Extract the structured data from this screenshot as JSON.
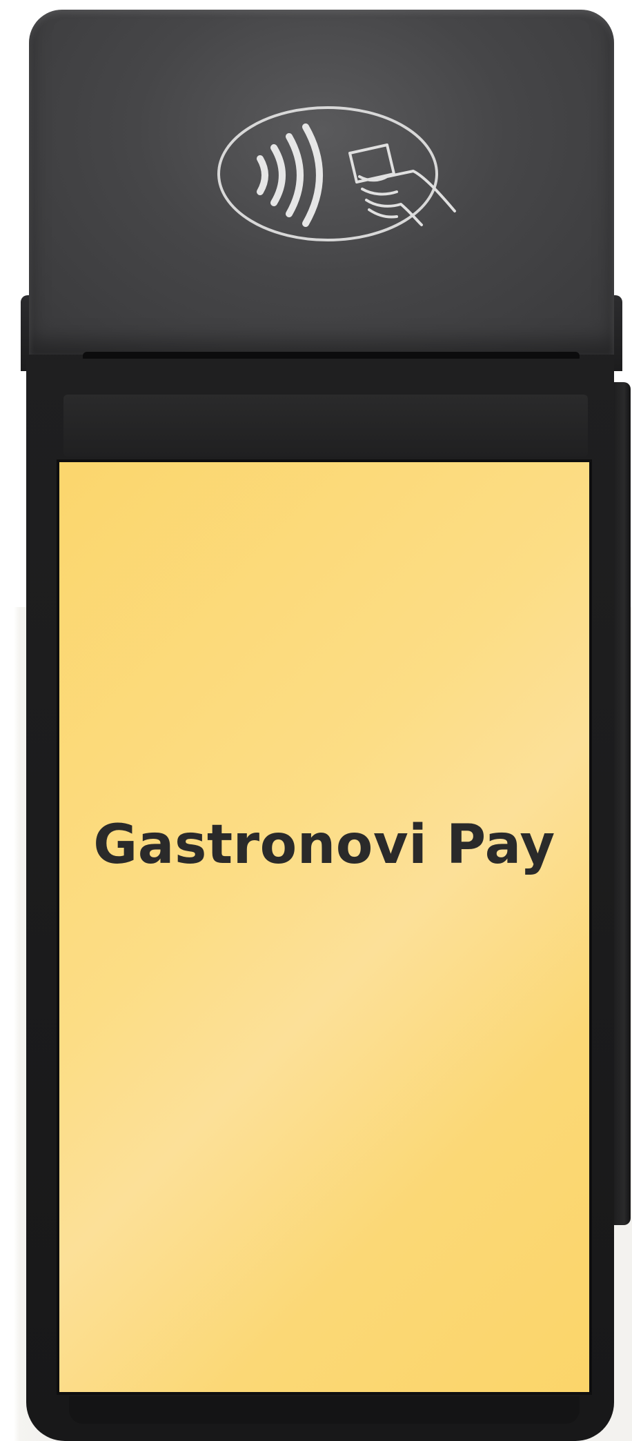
{
  "screen": {
    "brand_title": "Gastronovi Pay",
    "background_color": "#fbd66d",
    "text_color": "#2a2a2a"
  },
  "device": {
    "body_color": "#1f1f20",
    "head_color": "#464648",
    "nfc_icon": "contactless-payment-icon"
  }
}
